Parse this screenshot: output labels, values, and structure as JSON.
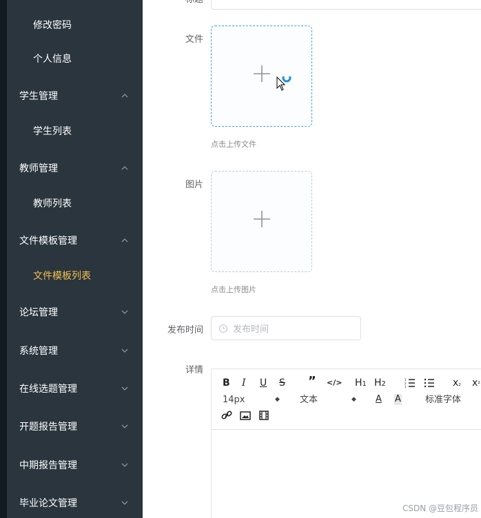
{
  "sidebar": {
    "items": [
      {
        "label": "修改密码",
        "type": "sub"
      },
      {
        "label": "个人信息",
        "type": "sub"
      },
      {
        "label": "学生管理",
        "type": "group",
        "expanded": true
      },
      {
        "label": "学生列表",
        "type": "sub"
      },
      {
        "label": "教师管理",
        "type": "group",
        "expanded": true
      },
      {
        "label": "教师列表",
        "type": "sub"
      },
      {
        "label": "文件模板管理",
        "type": "group",
        "expanded": true
      },
      {
        "label": "文件模板列表",
        "type": "sub",
        "active": true
      },
      {
        "label": "论坛管理",
        "type": "group",
        "expanded": false
      },
      {
        "label": "系统管理",
        "type": "group",
        "expanded": false
      },
      {
        "label": "在线选题管理",
        "type": "group",
        "expanded": false
      },
      {
        "label": "开题报告管理",
        "type": "group",
        "expanded": false
      },
      {
        "label": "中期报告管理",
        "type": "group",
        "expanded": false
      },
      {
        "label": "毕业论文管理",
        "type": "group",
        "expanded": false
      }
    ]
  },
  "form": {
    "title_label": "标题",
    "title_value": "......",
    "file_label": "文件",
    "file_hint": "点击上传文件",
    "image_label": "图片",
    "image_hint": "点击上传图片",
    "publish_label": "发布时间",
    "publish_placeholder": "发布时间",
    "detail_label": "详情"
  },
  "editor": {
    "font_size": "14px",
    "paragraph": "文本",
    "font_family": "标准字体",
    "buttons": [
      "bold",
      "italic",
      "underline",
      "strike",
      "blockquote",
      "code-block",
      "header-1",
      "header-2",
      "ordered-list",
      "bullet-list",
      "subscript",
      "superscript",
      "color",
      "background",
      "link",
      "image",
      "video"
    ]
  },
  "colors": {
    "sidebar_bg": "#2a353e",
    "active_menu": "#f5c04b",
    "upload_hover": "#409eff"
  },
  "watermark": "CSDN @豆包程序员"
}
